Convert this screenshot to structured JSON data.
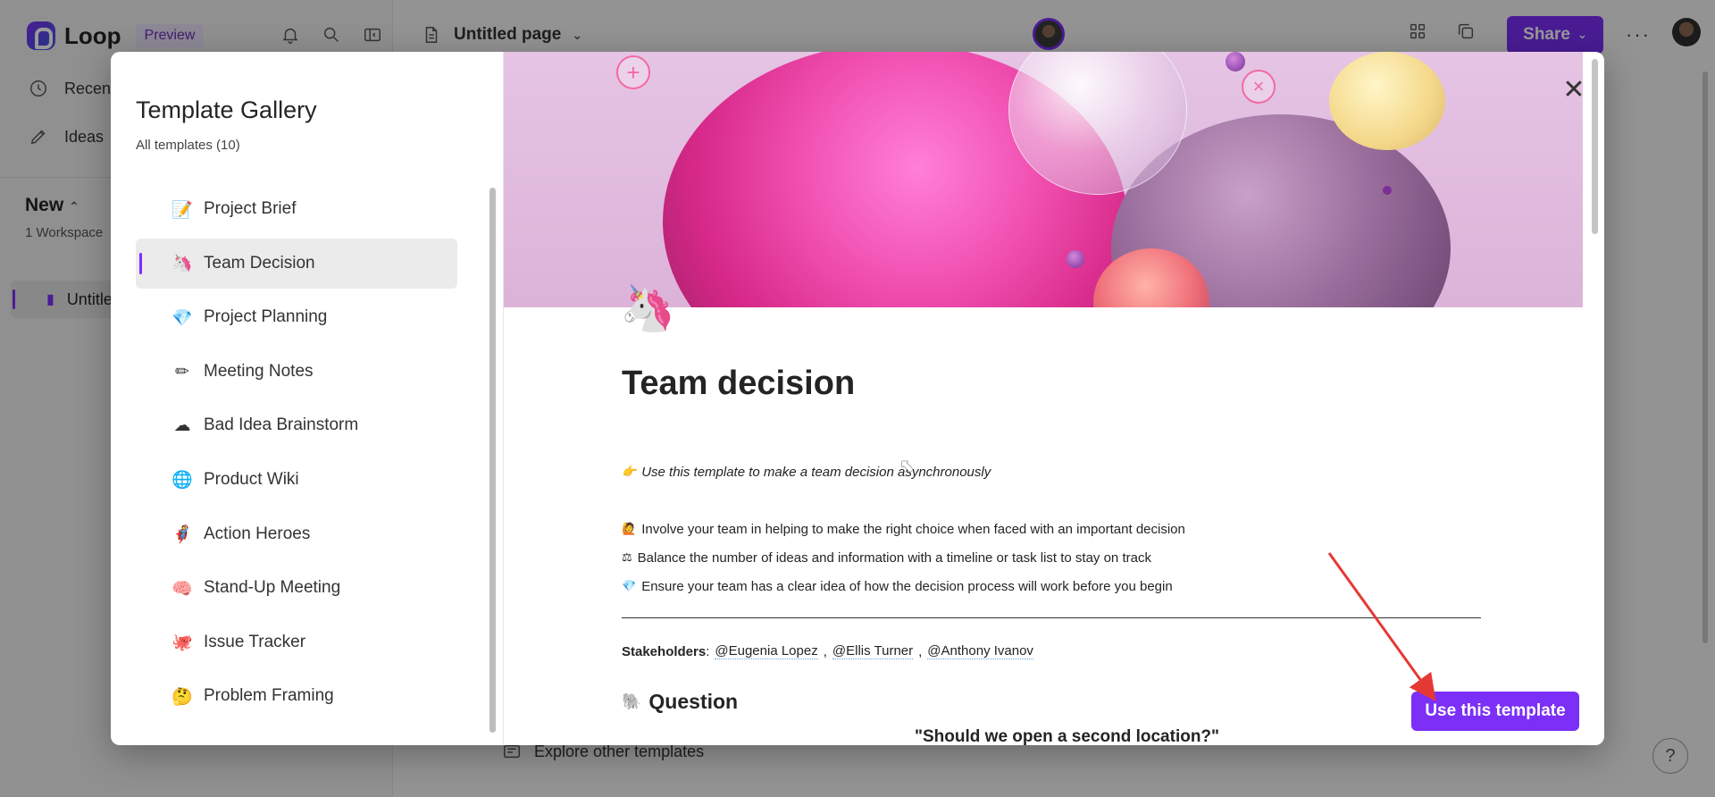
{
  "app": {
    "brand": "Loop",
    "badge": "Preview",
    "nav": {
      "recent": "Recent",
      "ideas": "Ideas"
    },
    "workspace": {
      "title": "New",
      "subtitle": "1 Workspace",
      "page_item": "Untitled page"
    },
    "header": {
      "page_title": "Untitled page",
      "share_label": "Share",
      "more_label": "···"
    },
    "explore_link": "Explore other templates",
    "help_label": "?"
  },
  "gallery": {
    "title": "Template Gallery",
    "count_label": "All templates (10)",
    "templates": [
      {
        "emoji": "📝",
        "label": "Project Brief"
      },
      {
        "emoji": "🦄",
        "label": "Team Decision",
        "selected": true
      },
      {
        "emoji": "💎",
        "label": "Project Planning"
      },
      {
        "emoji": "✏",
        "label": "Meeting Notes"
      },
      {
        "emoji": "☁",
        "label": "Bad Idea Brainstorm"
      },
      {
        "emoji": "🌐",
        "label": "Product Wiki"
      },
      {
        "emoji": "🦸",
        "label": "Action Heroes"
      },
      {
        "emoji": "🧠",
        "label": "Stand-Up Meeting"
      },
      {
        "emoji": "🐙",
        "label": "Issue Tracker"
      },
      {
        "emoji": "🤔",
        "label": "Problem Framing"
      }
    ]
  },
  "preview": {
    "icon": "🦄",
    "title": "Team decision",
    "intro": {
      "emoji": "👉",
      "text": "Use this template to make a team decision asynchronously"
    },
    "bullets": [
      {
        "emoji": "🙋",
        "text": "Involve your team in helping to make the right choice when faced with an important decision"
      },
      {
        "emoji": "⚖",
        "text": "Balance the number of ideas and information with a timeline or task list to stay on track"
      },
      {
        "emoji": "💎",
        "text": "Ensure your team has a clear idea of how the decision process will work before you begin"
      }
    ],
    "stakeholders": {
      "label": "Stakeholders",
      "mentions": [
        "@Eugenia Lopez",
        "@Ellis Turner",
        "@Anthony Ivanov"
      ]
    },
    "question": {
      "emoji": "🐘",
      "heading": "Question",
      "text": "\"Should we open a second location?\""
    },
    "use_button": "Use this template",
    "close_label": "✕"
  },
  "colors": {
    "accent": "#7b2ff7",
    "annotation_arrow": "#e53935"
  }
}
